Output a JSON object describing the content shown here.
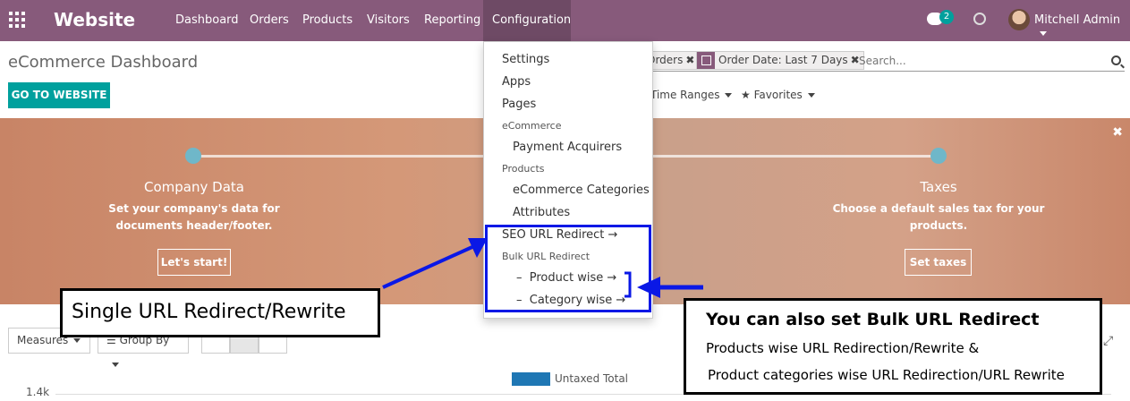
{
  "header": {
    "app_title": "Website",
    "nav": [
      "Dashboard",
      "Orders",
      "Products",
      "Visitors",
      "Reporting",
      "Configuration"
    ],
    "chat_badge": "2",
    "user_name": "Mitchell Admin"
  },
  "control_panel": {
    "page_title": "eCommerce Dashboard",
    "go_button": "GO TO WEBSITE",
    "facet_orders": "Orders",
    "facet_date": "Order Date: Last 7 Days",
    "search_placeholder": "Search...",
    "time_ranges": "Time Ranges",
    "favorites": "Favorites"
  },
  "banner": {
    "close": "✖",
    "steps": [
      {
        "title": "Company Data",
        "desc1": "Set your company's data for",
        "desc2": "documents header/footer.",
        "button": "Let's start!"
      },
      {
        "title": "Taxes",
        "desc1": "Choose a default sales tax for your",
        "desc2": "products.",
        "button": "Set taxes"
      }
    ]
  },
  "dropdown": {
    "settings": "Settings",
    "apps": "Apps",
    "pages": "Pages",
    "ecommerce_header": "eCommerce",
    "payment_acquirers": "Payment Acquirers",
    "products_header": "Products",
    "ecommerce_categories": "eCommerce Categories",
    "attributes": "Attributes",
    "seo_redirect": "SEO URL Redirect →",
    "bulk_header": "Bulk URL Redirect",
    "product_wise": "Product wise →",
    "category_wise": "Category wise →"
  },
  "annotations": {
    "single": "Single URL Redirect/Rewrite",
    "bulk_title": "You can also set Bulk URL Redirect",
    "bulk_line1": "Products wise URL Redirection/Rewrite &",
    "bulk_line2": "Product categories wise URL Redirection/URL Rewrite"
  },
  "bottom": {
    "measures": "Measures",
    "group_by": "Group By",
    "legend": "Untaxed Total",
    "ytick": "1.4k"
  },
  "colors": {
    "topbar": "#875a7b",
    "accent": "#00a09d",
    "annotation_blue": "#0a18e6"
  }
}
